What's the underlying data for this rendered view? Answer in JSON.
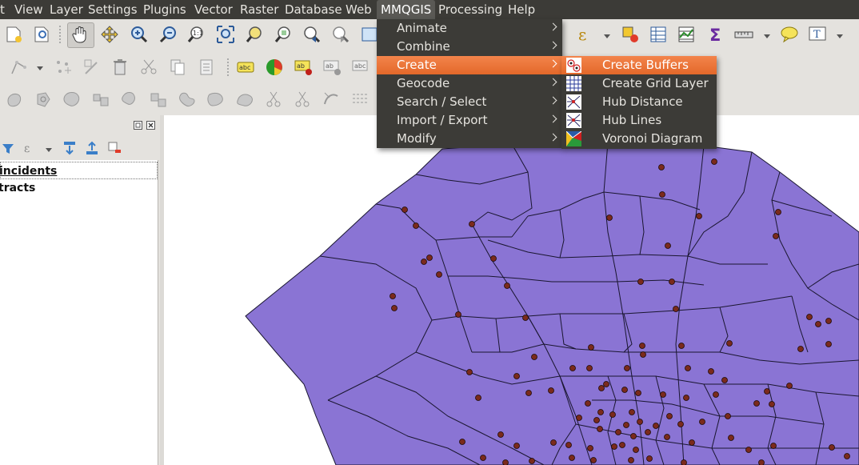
{
  "menubar": {
    "items": [
      "t",
      "View",
      "Layer",
      "Settings",
      "Plugins",
      "Vector",
      "Raster",
      "Database",
      "Web",
      "MMQGIS",
      "Processing",
      "Help"
    ]
  },
  "mmqgis_menu": {
    "items": [
      "Animate",
      "Combine",
      "Create",
      "Geocode",
      "Search / Select",
      "Import / Export",
      "Modify"
    ]
  },
  "create_submenu": {
    "items": [
      "Create Buffers",
      "Create Grid Layer",
      "Hub Distance",
      "Hub Lines",
      "Voronoi Diagram"
    ],
    "icons": [
      "buffers-icon",
      "grid-layer-icon",
      "hub-distance-icon",
      "hub-lines-icon",
      "voronoi-icon"
    ]
  },
  "layers": {
    "items": [
      "incidents",
      "tracts"
    ]
  },
  "map": {
    "polygon_color": "#8a74d4",
    "outline_color": "#1a1630",
    "point_color": "#7a2a1c"
  },
  "colors": {
    "menubar_bg": "#3c3b37",
    "highlight": "#e96c30"
  }
}
